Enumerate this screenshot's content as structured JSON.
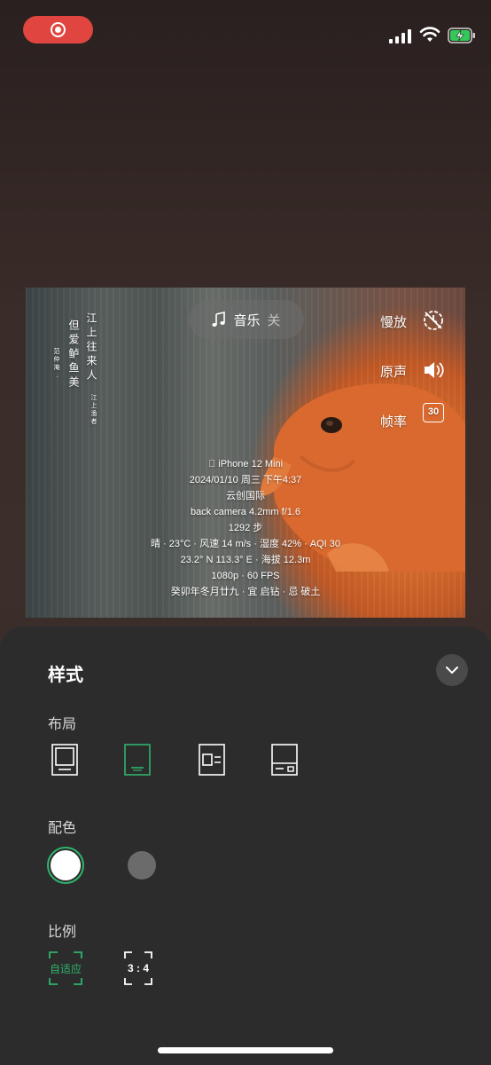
{
  "status_bar": {
    "recording_icon": "record-icon",
    "signal_icon": "cellular-signal-icon",
    "wifi_icon": "wifi-icon",
    "battery_icon": "battery-charging-icon"
  },
  "preview": {
    "poem": [
      "江上往来人",
      "但爱鲈鱼美",
      "范仲淹 ·",
      "江上渔者"
    ],
    "music": {
      "icon": "music-note-icon",
      "label": "音乐",
      "state": "关"
    },
    "controls": [
      {
        "label": "慢放",
        "icon": "slow-motion-off-icon"
      },
      {
        "label": "原声",
        "icon": "speaker-icon"
      },
      {
        "label": "帧率",
        "value": "30"
      }
    ],
    "device": "iPhone 12 Mini",
    "datetime": "2024/01/10 周三 下午4:37",
    "location": "云创国际",
    "camera": "back camera 4.2mm f/1.6",
    "steps": "1292 步",
    "weather": "晴 · 23°C · 风速 14 m/s · 湿度 42% · AQI 30",
    "coords": "23.2° N 113.3° E · 海拔 12.3m",
    "video": "1080p · 60 FPS",
    "almanac": "癸卯年冬月廿九 · 宜 启钻 · 忌 破土"
  },
  "sheet": {
    "title": "样式",
    "collapse_icon": "chevron-down-icon",
    "layout_label": "布局",
    "color_label": "配色",
    "ratio_label": "比例",
    "ratios": [
      "自适应",
      "3 : 4"
    ],
    "accent": "#2fb36c"
  }
}
